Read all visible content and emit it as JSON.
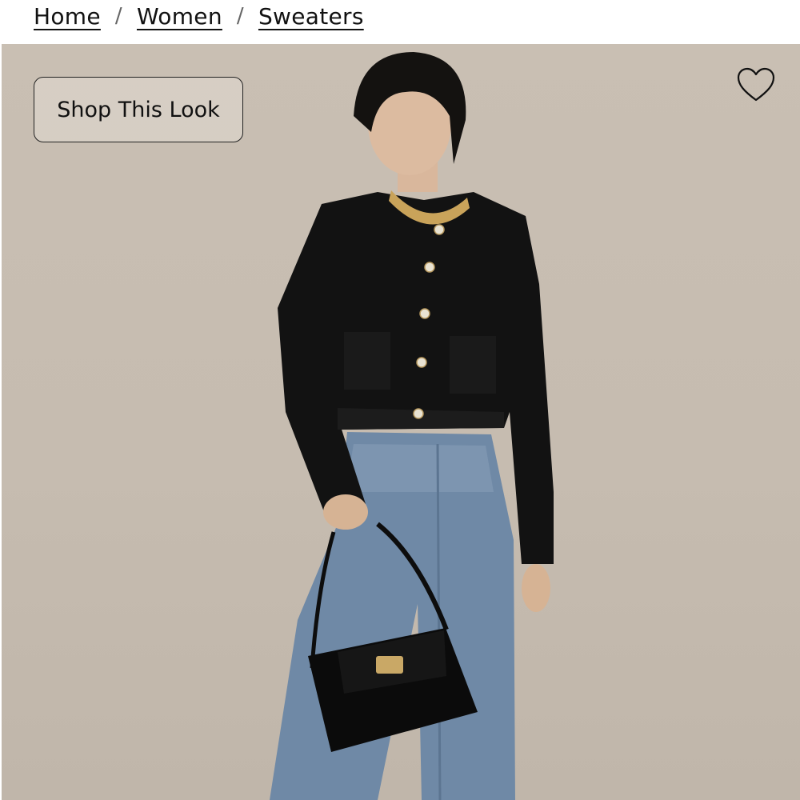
{
  "breadcrumb": {
    "items": [
      {
        "label": "Home"
      },
      {
        "label": "Women"
      },
      {
        "label": "Sweaters"
      }
    ],
    "separator": "/"
  },
  "hero": {
    "shop_look_label": "Shop This Look",
    "favorite_icon": "heart-outline-icon",
    "background_color": "#c8beb2"
  }
}
